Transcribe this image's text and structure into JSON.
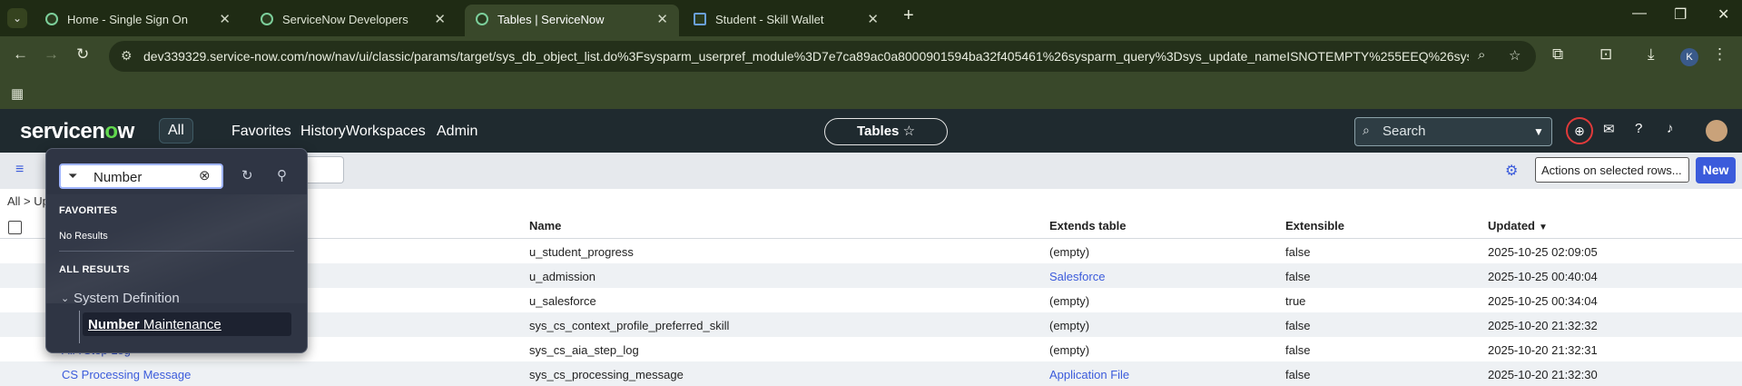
{
  "browser": {
    "tabs": [
      {
        "title": "Home - Single Sign On",
        "active": false
      },
      {
        "title": "ServiceNow Developers",
        "active": false
      },
      {
        "title": "Tables | ServiceNow",
        "active": true
      },
      {
        "title": "Student - Skill Wallet",
        "active": false
      }
    ],
    "url": "dev339329.service-now.com/now/nav/ui/classic/params/target/sys_db_object_list.do%3Fsysparm_userpref_module%3D7e7ca89ac0a8000901594ba32f405461%26sysparm_query%3Dsys_update_nameISNOTEMPTY%255EEQ%26sysparm...",
    "profile_initial": "K"
  },
  "header": {
    "logo_pre": "servicen",
    "logo_o": "o",
    "logo_post": "w",
    "nav": [
      "All",
      "Favorites",
      "History",
      "Workspaces",
      "Admin"
    ],
    "context_title": "Tables",
    "search_label": "Search"
  },
  "list": {
    "actions_label": "Actions on selected rows...",
    "new_label": "New",
    "breadcrumb": "All > Up",
    "columns": [
      "Name",
      "Extends table",
      "Extensible",
      "Updated"
    ],
    "rows": [
      {
        "label": "",
        "name": "u_student_progress",
        "extends": "(empty)",
        "extends_link": false,
        "extensible": "false",
        "updated": "2025-10-25 02:09:05"
      },
      {
        "label": "",
        "name": "u_admission",
        "extends": "Salesforce",
        "extends_link": true,
        "extensible": "false",
        "updated": "2025-10-25 00:40:04"
      },
      {
        "label": "",
        "name": "u_salesforce",
        "extends": "(empty)",
        "extends_link": false,
        "extensible": "true",
        "updated": "2025-10-25 00:34:04"
      },
      {
        "label": "",
        "name": "sys_cs_context_profile_preferred_skill",
        "extends": "(empty)",
        "extends_link": false,
        "extensible": "false",
        "updated": "2025-10-20 21:32:32"
      },
      {
        "label": "AIA Step Log",
        "name": "sys_cs_aia_step_log",
        "extends": "(empty)",
        "extends_link": false,
        "extensible": "false",
        "updated": "2025-10-20 21:32:31"
      },
      {
        "label": "CS Processing Message",
        "name": "sys_cs_processing_message",
        "extends": "Application File",
        "extends_link": true,
        "extensible": "false",
        "updated": "2025-10-20 21:32:30"
      }
    ]
  },
  "menu": {
    "filter_value": "Number",
    "favorites_heading": "FAVORITES",
    "favorites_empty": "No Results",
    "all_results_heading": "ALL RESULTS",
    "group": "System Definition",
    "result_match": "Number",
    "result_rest": " Maintenance"
  }
}
